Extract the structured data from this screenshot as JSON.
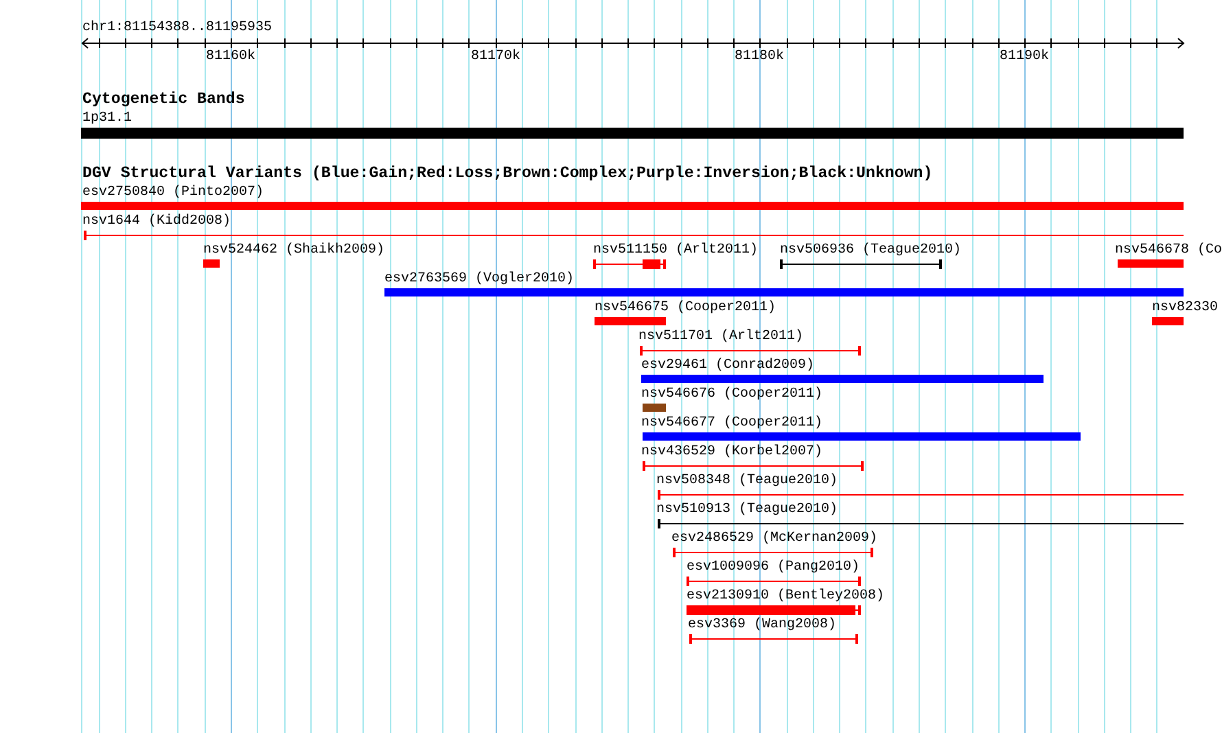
{
  "ruler": {
    "location": "chr1:81154388..81195935",
    "tick_labels": [
      "81160k",
      "81170k",
      "81180k",
      "81190k"
    ]
  },
  "cytogenetic_track": {
    "title": "Cytogenetic Bands",
    "band": "1p31.1"
  },
  "variants_track": {
    "title": "DGV Structural Variants (Blue:Gain;Red:Loss;Brown:Complex;Purple:Inversion;Black:Unknown)",
    "features": [
      {
        "label": "esv2750840 (Pinto2007)",
        "kind": "bar",
        "color": "#ff0000"
      },
      {
        "label": "nsv1644 (Kidd2008)",
        "kind": "span",
        "color": "#ff0000"
      },
      {
        "label": "nsv524462 (Shaikh2009)",
        "kind": "bar",
        "color": "#ff0000"
      },
      {
        "label": "nsv511150 (Arlt2011)",
        "kind": "span-bar",
        "color": "#ff0000"
      },
      {
        "label": "nsv506936 (Teague2010)",
        "kind": "span",
        "color": "#000000"
      },
      {
        "label": "nsv546678 (Co",
        "kind": "bar",
        "color": "#ff0000"
      },
      {
        "label": "esv2763569 (Vogler2010)",
        "kind": "bar",
        "color": "#0000ff"
      },
      {
        "label": "nsv546675 (Cooper2011)",
        "kind": "bar",
        "color": "#ff0000"
      },
      {
        "label": "nsv82330",
        "kind": "bar",
        "color": "#ff0000"
      },
      {
        "label": "nsv511701 (Arlt2011)",
        "kind": "span",
        "color": "#ff0000"
      },
      {
        "label": "esv29461 (Conrad2009)",
        "kind": "bar",
        "color": "#0000ff"
      },
      {
        "label": "nsv546676 (Cooper2011)",
        "kind": "bar",
        "color": "#8b4513"
      },
      {
        "label": "nsv546677 (Cooper2011)",
        "kind": "bar",
        "color": "#0000ff"
      },
      {
        "label": "nsv436529 (Korbel2007)",
        "kind": "span",
        "color": "#ff0000"
      },
      {
        "label": "nsv508348 (Teague2010)",
        "kind": "span",
        "color": "#ff0000"
      },
      {
        "label": "nsv510913 (Teague2010)",
        "kind": "span",
        "color": "#000000"
      },
      {
        "label": "esv2486529 (McKernan2009)",
        "kind": "span",
        "color": "#ff0000"
      },
      {
        "label": "esv1009096 (Pang2010)",
        "kind": "span",
        "color": "#ff0000"
      },
      {
        "label": "esv2130910 (Bentley2008)",
        "kind": "span-bar",
        "color": "#ff0000"
      },
      {
        "label": "esv3369 (Wang2008)",
        "kind": "span",
        "color": "#ff0000"
      }
    ]
  }
}
